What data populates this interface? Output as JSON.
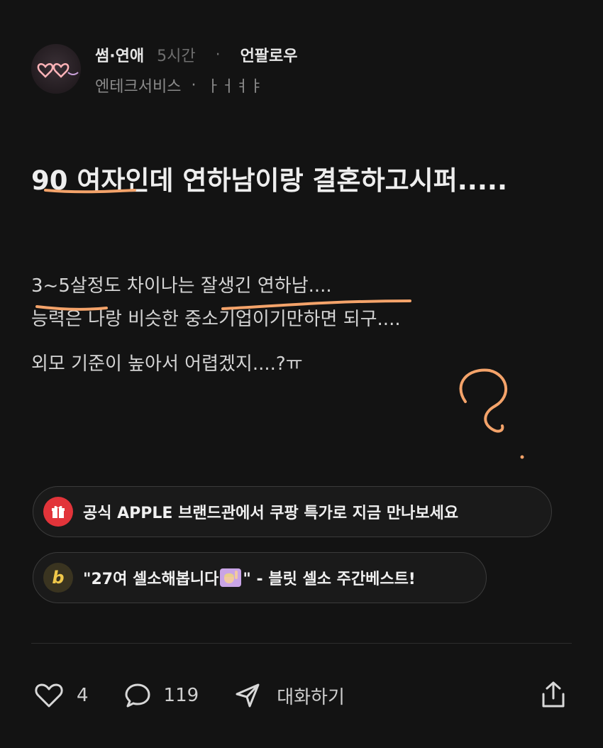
{
  "post": {
    "category": "썸·연애",
    "time": "5시간",
    "dot": "·",
    "follow_label": "언팔로우",
    "company": "엔테크서비스",
    "separator": "·",
    "author": "ㅏㅓㅕㅑ",
    "title": "90 여자인데 연하남이랑 결혼하고시퍼.....",
    "body": [
      "3~5살정도 차이나는 잘생긴 연하남....",
      "능력은 나랑 비슷한 중소기업이기만하면 되구....",
      "외모 기준이 높아서 어렵겠지....?ㅠ"
    ]
  },
  "ads": [
    {
      "icon": "gift-icon",
      "text": "공식 APPLE 브랜드관에서 쿠팡 특가로 지금 만나보세요",
      "color": "#e2343a"
    },
    {
      "icon": "b",
      "text_before": "\"27여 셀소해봅니다",
      "text_after": "\" - 블릿 셀소 주간베스트!",
      "color": "#f0c84a"
    }
  ],
  "actions": {
    "likes": "4",
    "comments": "119",
    "chat_label": "대화하기"
  },
  "colors": {
    "background": "#131313",
    "annotation": "#f4a36a"
  }
}
